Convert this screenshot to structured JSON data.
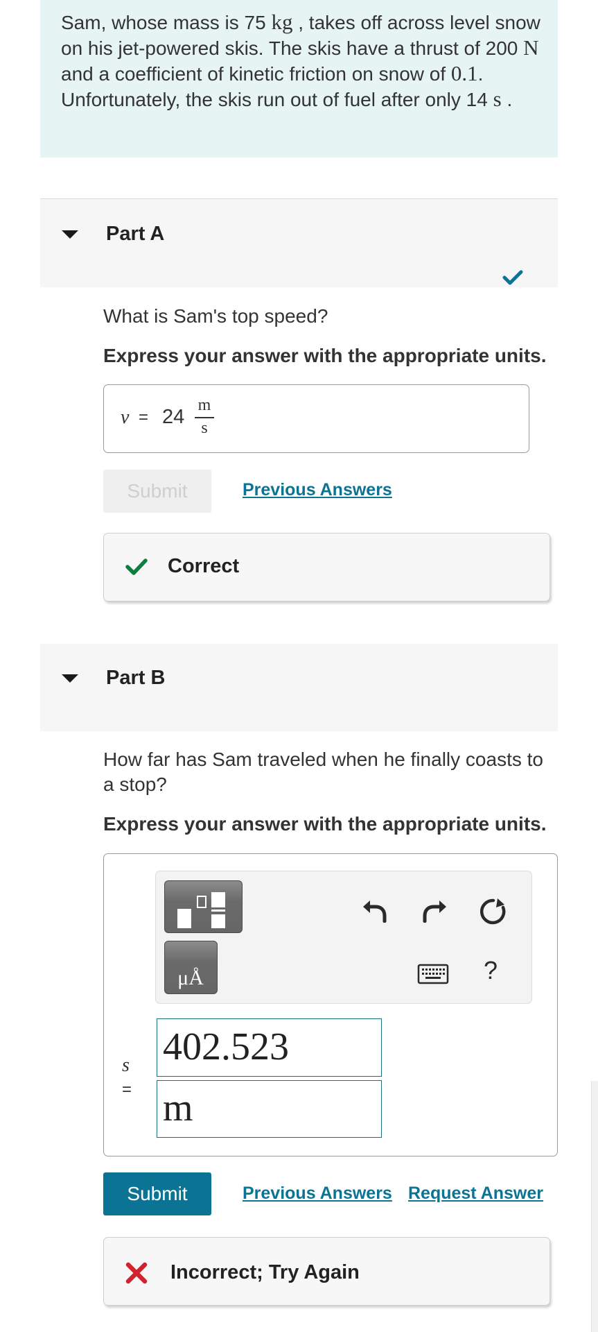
{
  "problem": {
    "seg1": "Sam, whose mass is 75 ",
    "unit_kg": "kg",
    "seg2": " , takes off across level snow on his jet-powered skis. The skis have a thrust of 200 ",
    "unit_N": "N",
    "seg3": " and a coefficient of kinetic friction on snow of ",
    "mu": "0.1",
    "seg4": ". Unfortunately, the skis run out of fuel after only 14 ",
    "unit_s": "s",
    "seg5": " ."
  },
  "part_a": {
    "title": "Part A",
    "question": "What is Sam's top speed?",
    "instruction": "Express your answer with the appropriate units.",
    "answer": {
      "variable": "v",
      "equals": "=",
      "value": "24",
      "unit_numerator": "m",
      "unit_denominator": "s"
    },
    "submit_label": "Submit",
    "previous_answers_label": "Previous Answers",
    "feedback": "Correct",
    "status": "correct"
  },
  "part_b": {
    "title": "Part B",
    "question": "How far has Sam traveled when he finally coasts to a stop?",
    "instruction": "Express your answer with the appropriate units.",
    "toolbar": {
      "units_button_label": "μÅ",
      "help_label": "?",
      "icons": [
        "templates-icon",
        "units-icon",
        "undo-icon",
        "redo-icon",
        "reset-icon",
        "keyboard-icon",
        "help-icon"
      ]
    },
    "answer": {
      "variable": "s",
      "equals": "=",
      "value": "402.523",
      "unit": "m"
    },
    "submit_label": "Submit",
    "previous_answers_label": "Previous Answers",
    "request_answer_label": "Request Answer",
    "feedback": "Incorrect; Try Again",
    "status": "incorrect"
  },
  "colors": {
    "accent": "#0b7393",
    "correct_green": "#0e7d3e",
    "incorrect_red": "#d0232e",
    "problem_bg": "#e6f5f4",
    "part_header_bg": "#f6f6f6"
  }
}
